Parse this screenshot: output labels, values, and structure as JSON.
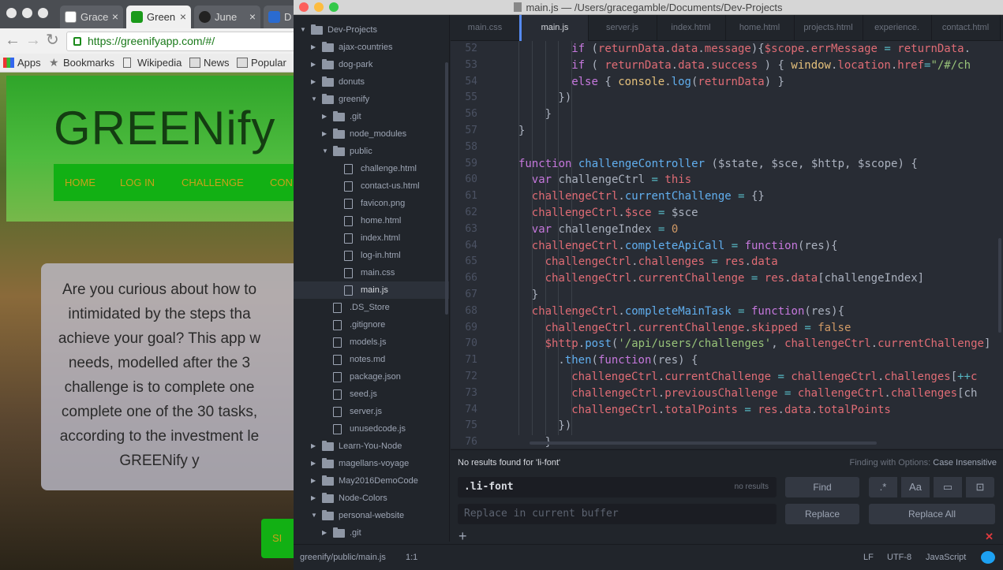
{
  "browser": {
    "tabs": [
      {
        "label": "Grace",
        "close": "×"
      },
      {
        "label": "Green",
        "close": "×"
      },
      {
        "label": "June",
        "close": "×"
      },
      {
        "label": "D",
        "close": ""
      }
    ],
    "url": "https://greenifyapp.com/#/",
    "bookmarks": [
      "Apps",
      "Bookmarks",
      "Wikipedia",
      "News",
      "Popular"
    ],
    "page": {
      "title": "GREENify",
      "nav": [
        "HOME",
        "LOG IN",
        "CHALLENGE",
        "CON"
      ],
      "intro_lines": [
        "Are you curious about how to",
        "intimidated by the steps tha",
        "achieve your goal? This app w",
        "needs, modelled after the 3",
        "challenge is to complete one",
        "complete one of the 30 tasks,",
        "according to the investment le",
        "GREENify y"
      ],
      "button": "SI"
    }
  },
  "editor": {
    "title": "main.js — /Users/gracegamble/Documents/Dev-Projects",
    "tree": [
      {
        "label": "Dev-Projects",
        "type": "root"
      },
      {
        "label": "ajax-countries",
        "type": "folder",
        "depth": 1
      },
      {
        "label": "dog-park",
        "type": "folder",
        "depth": 1
      },
      {
        "label": "donuts",
        "type": "folder",
        "depth": 1
      },
      {
        "label": "greenify",
        "type": "folder-open",
        "depth": 1
      },
      {
        "label": ".git",
        "type": "folder",
        "depth": 2
      },
      {
        "label": "node_modules",
        "type": "folder",
        "depth": 2
      },
      {
        "label": "public",
        "type": "folder-open",
        "depth": 2
      },
      {
        "label": "challenge.html",
        "type": "file",
        "depth": 3
      },
      {
        "label": "contact-us.html",
        "type": "file",
        "depth": 3
      },
      {
        "label": "favicon.png",
        "type": "file",
        "depth": 3
      },
      {
        "label": "home.html",
        "type": "file",
        "depth": 3
      },
      {
        "label": "index.html",
        "type": "file",
        "depth": 3
      },
      {
        "label": "log-in.html",
        "type": "file",
        "depth": 3
      },
      {
        "label": "main.css",
        "type": "file",
        "depth": 3
      },
      {
        "label": "main.js",
        "type": "file",
        "depth": 3,
        "selected": true
      },
      {
        "label": ".DS_Store",
        "type": "file",
        "depth": 2
      },
      {
        "label": ".gitignore",
        "type": "file",
        "depth": 2
      },
      {
        "label": "models.js",
        "type": "file",
        "depth": 2
      },
      {
        "label": "notes.md",
        "type": "file",
        "depth": 2
      },
      {
        "label": "package.json",
        "type": "file",
        "depth": 2
      },
      {
        "label": "seed.js",
        "type": "file",
        "depth": 2
      },
      {
        "label": "server.js",
        "type": "file",
        "depth": 2
      },
      {
        "label": "unusedcode.js",
        "type": "file",
        "depth": 2
      },
      {
        "label": "Learn-You-Node",
        "type": "folder",
        "depth": 1
      },
      {
        "label": "magellans-voyage",
        "type": "folder",
        "depth": 1
      },
      {
        "label": "May2016DemoCode",
        "type": "folder",
        "depth": 1
      },
      {
        "label": "Node-Colors",
        "type": "folder",
        "depth": 1
      },
      {
        "label": "personal-website",
        "type": "folder-open",
        "depth": 1
      },
      {
        "label": ".git",
        "type": "folder",
        "depth": 2
      }
    ],
    "tabs": [
      "main.css",
      "main.js",
      "server.js",
      "index.html",
      "home.html",
      "projects.html",
      "experience.",
      "contact.html"
    ],
    "active_tab": 1,
    "code": [
      {
        "n": "52",
        "i": 5,
        "t": [
          [
            "kw",
            "if"
          ],
          [
            "pl",
            " ("
          ],
          [
            "vr",
            "returnData"
          ],
          [
            "pl",
            "."
          ],
          [
            "vr",
            "data"
          ],
          [
            "pl",
            "."
          ],
          [
            "vr",
            "message"
          ],
          [
            "pl",
            "){"
          ],
          [
            "vr",
            "$scope"
          ],
          [
            "pl",
            "."
          ],
          [
            "vr",
            "errMessage"
          ],
          [
            "pl",
            " "
          ],
          [
            "op",
            "="
          ],
          [
            "pl",
            " "
          ],
          [
            "vr",
            "returnData"
          ],
          [
            "pl",
            "."
          ]
        ]
      },
      {
        "n": "53",
        "i": 5,
        "t": [
          [
            "kw",
            "if"
          ],
          [
            "pl",
            " ( "
          ],
          [
            "vr",
            "returnData"
          ],
          [
            "pl",
            "."
          ],
          [
            "vr",
            "data"
          ],
          [
            "pl",
            "."
          ],
          [
            "vr",
            "success"
          ],
          [
            "pl",
            " ) { "
          ],
          [
            "ob",
            "window"
          ],
          [
            "pl",
            "."
          ],
          [
            "vr",
            "location"
          ],
          [
            "pl",
            "."
          ],
          [
            "vr",
            "href"
          ],
          [
            "op",
            "="
          ],
          [
            "st",
            "\"/#/ch"
          ]
        ]
      },
      {
        "n": "54",
        "i": 5,
        "t": [
          [
            "kw",
            "else"
          ],
          [
            "pl",
            " { "
          ],
          [
            "ob",
            "console"
          ],
          [
            "pl",
            "."
          ],
          [
            "fn",
            "log"
          ],
          [
            "pl",
            "("
          ],
          [
            "vr",
            "returnData"
          ],
          [
            "pl",
            ") }"
          ]
        ]
      },
      {
        "n": "55",
        "i": 4,
        "t": [
          [
            "pl",
            "})"
          ]
        ]
      },
      {
        "n": "56",
        "i": 3,
        "t": [
          [
            "pl",
            "}"
          ]
        ]
      },
      {
        "n": "57",
        "i": 1,
        "t": [
          [
            "pl",
            "}"
          ]
        ]
      },
      {
        "n": "58",
        "i": 0,
        "t": []
      },
      {
        "n": "59",
        "i": 1,
        "t": [
          [
            "kw",
            "function"
          ],
          [
            "pl",
            " "
          ],
          [
            "fn",
            "challengeController"
          ],
          [
            "pl",
            " ($state, $sce, $http, $scope) {"
          ]
        ]
      },
      {
        "n": "60",
        "i": 2,
        "t": [
          [
            "kw",
            "var"
          ],
          [
            "pl",
            " challengeCtrl "
          ],
          [
            "op",
            "="
          ],
          [
            "pl",
            " "
          ],
          [
            "vr",
            "this"
          ]
        ]
      },
      {
        "n": "61",
        "i": 2,
        "t": [
          [
            "vr",
            "challengeCtrl"
          ],
          [
            "pl",
            "."
          ],
          [
            "fn",
            "currentChallenge"
          ],
          [
            "pl",
            " "
          ],
          [
            "op",
            "="
          ],
          [
            "pl",
            " {}"
          ]
        ]
      },
      {
        "n": "62",
        "i": 2,
        "t": [
          [
            "vr",
            "challengeCtrl"
          ],
          [
            "pl",
            "."
          ],
          [
            "vr",
            "$sce"
          ],
          [
            "pl",
            " "
          ],
          [
            "op",
            "="
          ],
          [
            "pl",
            " $sce"
          ]
        ]
      },
      {
        "n": "63",
        "i": 2,
        "t": [
          [
            "kw",
            "var"
          ],
          [
            "pl",
            " challengeIndex "
          ],
          [
            "op",
            "="
          ],
          [
            "pl",
            " "
          ],
          [
            "nm",
            "0"
          ]
        ]
      },
      {
        "n": "64",
        "i": 2,
        "t": [
          [
            "vr",
            "challengeCtrl"
          ],
          [
            "pl",
            "."
          ],
          [
            "fn",
            "completeApiCall"
          ],
          [
            "pl",
            " "
          ],
          [
            "op",
            "="
          ],
          [
            "pl",
            " "
          ],
          [
            "kw",
            "function"
          ],
          [
            "pl",
            "(res){"
          ]
        ]
      },
      {
        "n": "65",
        "i": 3,
        "t": [
          [
            "vr",
            "challengeCtrl"
          ],
          [
            "pl",
            "."
          ],
          [
            "vr",
            "challenges"
          ],
          [
            "pl",
            " "
          ],
          [
            "op",
            "="
          ],
          [
            "pl",
            " "
          ],
          [
            "vr",
            "res"
          ],
          [
            "pl",
            "."
          ],
          [
            "vr",
            "data"
          ]
        ]
      },
      {
        "n": "66",
        "i": 3,
        "t": [
          [
            "vr",
            "challengeCtrl"
          ],
          [
            "pl",
            "."
          ],
          [
            "vr",
            "currentChallenge"
          ],
          [
            "pl",
            " "
          ],
          [
            "op",
            "="
          ],
          [
            "pl",
            " "
          ],
          [
            "vr",
            "res"
          ],
          [
            "pl",
            "."
          ],
          [
            "vr",
            "data"
          ],
          [
            "pl",
            "[challengeIndex]"
          ]
        ]
      },
      {
        "n": "67",
        "i": 2,
        "t": [
          [
            "pl",
            "}"
          ]
        ]
      },
      {
        "n": "68",
        "i": 2,
        "t": [
          [
            "vr",
            "challengeCtrl"
          ],
          [
            "pl",
            "."
          ],
          [
            "fn",
            "completeMainTask"
          ],
          [
            "pl",
            " "
          ],
          [
            "op",
            "="
          ],
          [
            "pl",
            " "
          ],
          [
            "kw",
            "function"
          ],
          [
            "pl",
            "(res){"
          ]
        ]
      },
      {
        "n": "69",
        "i": 3,
        "t": [
          [
            "vr",
            "challengeCtrl"
          ],
          [
            "pl",
            "."
          ],
          [
            "vr",
            "currentChallenge"
          ],
          [
            "pl",
            "."
          ],
          [
            "vr",
            "skipped"
          ],
          [
            "pl",
            " "
          ],
          [
            "op",
            "="
          ],
          [
            "pl",
            " "
          ],
          [
            "nm",
            "false"
          ]
        ]
      },
      {
        "n": "70",
        "i": 3,
        "t": [
          [
            "vr",
            "$http"
          ],
          [
            "pl",
            "."
          ],
          [
            "fn",
            "post"
          ],
          [
            "pl",
            "("
          ],
          [
            "st",
            "'/api/users/challenges'"
          ],
          [
            "pl",
            ", "
          ],
          [
            "vr",
            "challengeCtrl"
          ],
          [
            "pl",
            "."
          ],
          [
            "vr",
            "currentChallenge"
          ],
          [
            "pl",
            "]"
          ]
        ]
      },
      {
        "n": "71",
        "i": 4,
        "t": [
          [
            "pl",
            "."
          ],
          [
            "fn",
            "then"
          ],
          [
            "pl",
            "("
          ],
          [
            "kw",
            "function"
          ],
          [
            "pl",
            "(res) {"
          ]
        ]
      },
      {
        "n": "72",
        "i": 5,
        "t": [
          [
            "vr",
            "challengeCtrl"
          ],
          [
            "pl",
            "."
          ],
          [
            "vr",
            "currentChallenge"
          ],
          [
            "pl",
            " "
          ],
          [
            "op",
            "="
          ],
          [
            "pl",
            " "
          ],
          [
            "vr",
            "challengeCtrl"
          ],
          [
            "pl",
            "."
          ],
          [
            "vr",
            "challenges"
          ],
          [
            "pl",
            "["
          ],
          [
            "op",
            "++"
          ],
          [
            "vr",
            "c"
          ]
        ]
      },
      {
        "n": "73",
        "i": 5,
        "t": [
          [
            "vr",
            "challengeCtrl"
          ],
          [
            "pl",
            "."
          ],
          [
            "vr",
            "previousChallenge"
          ],
          [
            "pl",
            " "
          ],
          [
            "op",
            "="
          ],
          [
            "pl",
            " "
          ],
          [
            "vr",
            "challengeCtrl"
          ],
          [
            "pl",
            "."
          ],
          [
            "vr",
            "challenges"
          ],
          [
            "pl",
            "[ch"
          ]
        ]
      },
      {
        "n": "74",
        "i": 5,
        "t": [
          [
            "vr",
            "challengeCtrl"
          ],
          [
            "pl",
            "."
          ],
          [
            "vr",
            "totalPoints"
          ],
          [
            "pl",
            " "
          ],
          [
            "op",
            "="
          ],
          [
            "pl",
            " "
          ],
          [
            "vr",
            "res"
          ],
          [
            "pl",
            "."
          ],
          [
            "vr",
            "data"
          ],
          [
            "pl",
            "."
          ],
          [
            "vr",
            "totalPoints"
          ]
        ]
      },
      {
        "n": "75",
        "i": 4,
        "t": [
          [
            "pl",
            "})"
          ]
        ]
      },
      {
        "n": "76",
        "i": 3,
        "t": [
          [
            "pl",
            "}"
          ]
        ]
      }
    ],
    "find": {
      "status": "No results found for 'li-font'",
      "options_label": "Finding with Options:",
      "options_value": "Case Insensitive",
      "query": ".li-font",
      "count": "no results",
      "find_button": "Find",
      "replace_placeholder": "Replace in current buffer",
      "replace_button": "Replace",
      "replace_all_button": "Replace All",
      "option_icons": [
        ".*",
        "Aa",
        "▭",
        "⊡"
      ]
    },
    "status": {
      "path": "greenify/public/main.js",
      "cursor": "1:1",
      "line_ending": "LF",
      "encoding": "UTF-8",
      "grammar": "JavaScript"
    }
  },
  "colors": {
    "accent": "#568af2",
    "editor_bg": "#282c34",
    "greenify_green": "#12b014"
  }
}
